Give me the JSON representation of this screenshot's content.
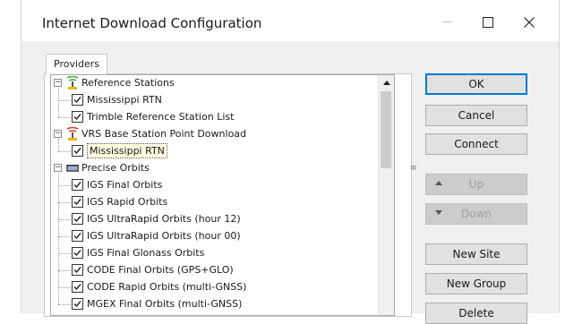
{
  "window": {
    "title": "Internet Download Configuration",
    "minimize_glyph": "—",
    "maximize_glyph": "☐",
    "close_glyph": "✕"
  },
  "tabs": [
    {
      "label": "Providers"
    }
  ],
  "tree": {
    "groups": [
      {
        "label": "Reference Stations",
        "icon": "antenna-green-icon",
        "items": [
          "Mississippi RTN",
          "Trimble Reference Station List"
        ]
      },
      {
        "label": "VRS Base Station Point Download",
        "icon": "antenna-red-icon",
        "items": [
          "Mississippi RTN"
        ],
        "selected_item": "Mississippi RTN"
      },
      {
        "label": "Precise Orbits",
        "icon": "satellite-icon",
        "items": [
          "IGS Final Orbits",
          "IGS Rapid Orbits",
          "IGS UltraRapid Orbits (hour 12)",
          "IGS UltraRapid Orbits (hour 00)",
          "IGS Final Glonass Orbits",
          "CODE Final Orbits (GPS+GLO)",
          "CODE Rapid Orbits (multi-GNSS)",
          "MGEX Final Orbits (multi-GNSS)"
        ]
      }
    ]
  },
  "buttons": {
    "ok": "OK",
    "cancel": "Cancel",
    "connect": "Connect",
    "up": "Up",
    "down": "Down",
    "new_site": "New Site",
    "new_group": "New Group",
    "delete": "Delete"
  },
  "colors": {
    "accent": "#0078d7",
    "disabled_button": "#cccccc",
    "selection_bg": "#ffffe1"
  }
}
